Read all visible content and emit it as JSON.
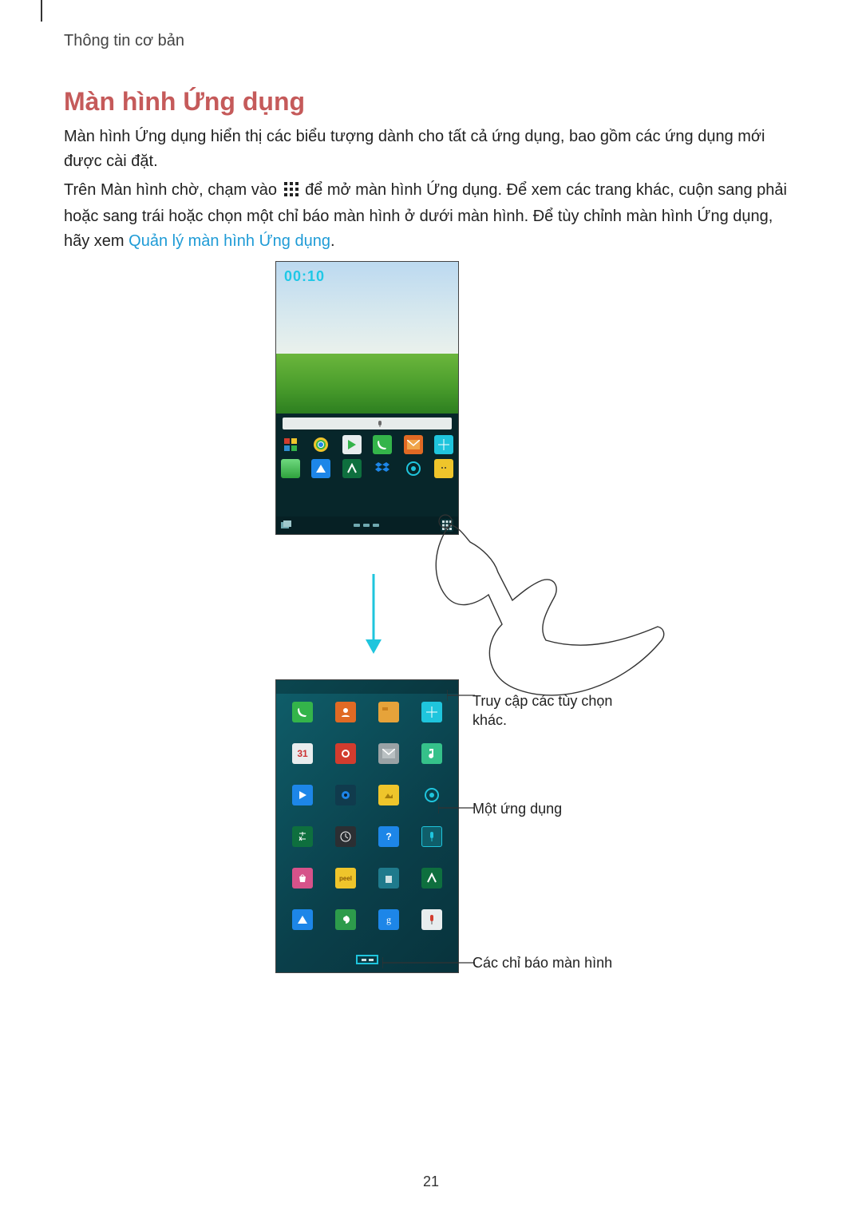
{
  "breadcrumb": "Thông tin cơ bản",
  "title": "Màn hình Ứng dụng",
  "para1": "Màn hình Ứng dụng hiển thị các biểu tượng dành cho tất cả ứng dụng, bao gồm các ứng dụng mới được cài đặt.",
  "para2_a": "Trên Màn hình chờ, chạm vào ",
  "para2_b": " để mở màn hình Ứng dụng. Để xem các trang khác, cuộn sang phải hoặc sang trái hoặc chọn một chỉ báo màn hình ở dưới màn hình. Để tùy chỉnh màn hình Ứng dụng, hãy xem ",
  "para2_link": "Quản lý màn hình Ứng dụng",
  "para2_c": ".",
  "home_clock": "00:10",
  "callout_options": "Truy cập các tùy chọn khác.",
  "callout_app": "Một ứng dụng",
  "callout_indicator": "Các chỉ báo màn hình",
  "page_number": "21"
}
